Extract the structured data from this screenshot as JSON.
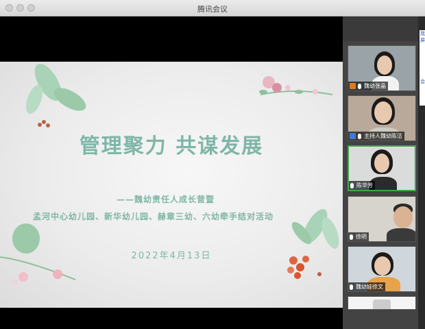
{
  "window": {
    "title": "腾讯会议"
  },
  "slide": {
    "title": "管理聚力  共谋发展",
    "subtitle_line1": "——魏幼责任人成长营暨",
    "subtitle_line2": "孟河中心幼儿园、新华幼儿园、赫章三幼、六幼牵手结对活动",
    "date": "2022年4月13日"
  },
  "participants": [
    {
      "name": "魏幼张晶",
      "role_icon": "host-icon",
      "muted": false,
      "active": false
    },
    {
      "name": "主持人魏幼陈洁",
      "role_icon": "cohost-icon",
      "muted": false,
      "active": false
    },
    {
      "name": "陈华芳",
      "role_icon": "",
      "muted": false,
      "active": true
    },
    {
      "name": "徐明",
      "role_icon": "",
      "muted": false,
      "active": false
    },
    {
      "name": "魏幼娃徐文",
      "role_icon": "",
      "muted": false,
      "active": false
    }
  ],
  "side_strip": {
    "text1": "我屏",
    "text2": "会"
  },
  "colors": {
    "accent_green": "#3fa64b",
    "slide_text": "#7fb6a6"
  }
}
